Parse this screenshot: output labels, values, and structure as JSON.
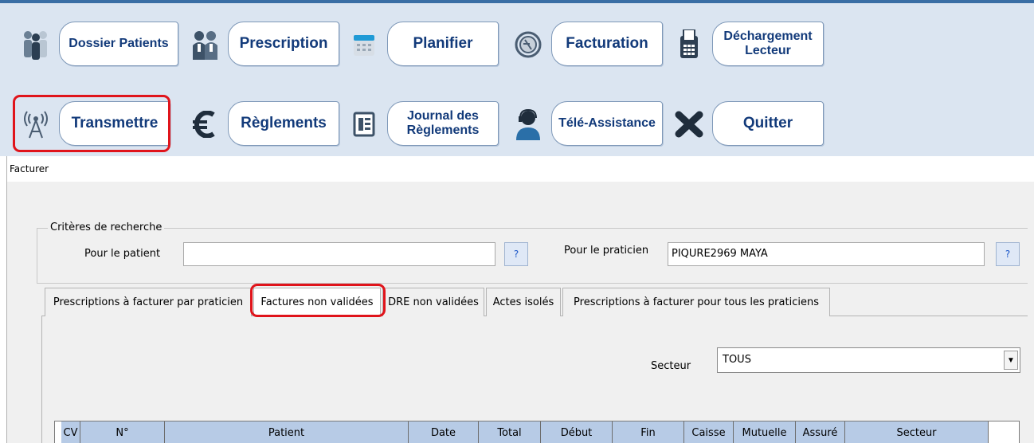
{
  "toolbar": {
    "row1": [
      {
        "label": "Dossier Patients",
        "icon": "people-icon"
      },
      {
        "label": "Prescription",
        "icon": "couple-icon"
      },
      {
        "label": "Planifier",
        "icon": "calendar-icon"
      },
      {
        "label": "Facturation",
        "icon": "coin-icon"
      },
      {
        "label": "Déchargement Lecteur",
        "icon": "card-reader-icon"
      }
    ],
    "row2": [
      {
        "label": "Transmettre",
        "icon": "antenna-icon"
      },
      {
        "label": "Règlements",
        "icon": "euro-icon"
      },
      {
        "label": "Journal des Règlements",
        "icon": "journal-icon"
      },
      {
        "label": "Télé-Assistance",
        "icon": "headset-operator-icon"
      },
      {
        "label": "Quitter",
        "icon": "close-x-icon"
      }
    ]
  },
  "window": {
    "title": "Facturer"
  },
  "criteria": {
    "legend": "Critères de recherche",
    "patient_label": "Pour le patient",
    "patient_value": "",
    "patient_lookup": "?",
    "praticien_label": "Pour le praticien",
    "praticien_value": "PIQURE2969 MAYA",
    "praticien_lookup": "?"
  },
  "tabs": [
    {
      "label": "Prescriptions à facturer par praticien",
      "active": false
    },
    {
      "label": "Factures non validées",
      "active": true
    },
    {
      "label": "DRE non validées",
      "active": false
    },
    {
      "label": "Actes isolés",
      "active": false
    },
    {
      "label": "Prescriptions à facturer pour tous les praticiens",
      "active": false
    }
  ],
  "secteur": {
    "label": "Secteur",
    "value": "TOUS"
  },
  "grid": {
    "columns": [
      "CV",
      "N°",
      "Patient",
      "Date",
      "Total",
      "Début",
      "Fin",
      "Caisse",
      "Mutuelle",
      "Assuré",
      "Secteur"
    ]
  },
  "colors": {
    "toolbar_bg": "#dbe5f1",
    "button_text": "#123a7a",
    "highlight": "#e0141b",
    "grid_header": "#b7cbe6"
  }
}
